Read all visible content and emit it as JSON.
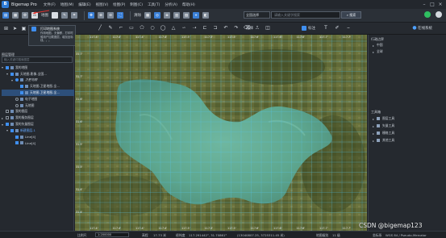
{
  "app": {
    "title": "Bigemap Pro",
    "logo_letter": "B",
    "menus": [
      "文件(F)",
      "地图(M)",
      "编辑(E)",
      "视图(V)",
      "绘图(P)",
      "制图(C)",
      "工具(T)",
      "分析(A)",
      "帮助(H)"
    ]
  },
  "toolbar1": {
    "map_label": "地图",
    "clear_label": "清除",
    "province_select": "全国选择",
    "search_placeholder": "请输入关键字搜索",
    "search_button": "搜索"
  },
  "toolbar2": {
    "select_label": "选择",
    "measure_label": "测量",
    "report_label": "上报",
    "marker_label": "标注",
    "online_label": "在线系统"
  },
  "left_panel": {
    "title": "图层管理",
    "search_placeholder": "输入关键词搜索图层",
    "popup": {
      "title": "打印地图系统",
      "description": "作用地图，无偏移，打印时候用户加载图层，增加坐标线。。。"
    },
    "tree": [
      {
        "label": "我的地图",
        "level": 0,
        "chev": "▾",
        "kind": "cb",
        "on": true
      },
      {
        "label": "天地图-影像-全国...",
        "level": 1,
        "chev": "▾",
        "kind": "cb",
        "on": true
      },
      {
        "label": "卫星地图",
        "level": 2,
        "chev": "▾",
        "kind": "radio",
        "on": true,
        "italic": true
      },
      {
        "label": "天地图-卫星地图-全...",
        "level": 3,
        "chev": "",
        "kind": "cb",
        "on": true
      },
      {
        "label": "天地图-卫星地图-全...",
        "level": 3,
        "chev": "",
        "kind": "cb",
        "on": true,
        "selected": true
      },
      {
        "label": "电子地图",
        "level": 2,
        "chev": "",
        "kind": "radio",
        "on": false
      },
      {
        "label": "无地图",
        "level": 2,
        "chev": "",
        "kind": "radio",
        "on": false
      },
      {
        "label": "我的图层",
        "level": 0,
        "chev": "",
        "kind": "cb",
        "on": false
      },
      {
        "label": "我的服务图层",
        "level": 0,
        "chev": "▸",
        "kind": "cb",
        "on": false
      },
      {
        "label": "我的矢量图层",
        "level": 0,
        "chev": "▾",
        "kind": "cb",
        "on": true
      },
      {
        "label": "新建图层-1",
        "level": 1,
        "chev": "▾",
        "kind": "cb",
        "on": true,
        "blue": true
      },
      {
        "label": "Line[4]",
        "level": 2,
        "chev": "",
        "kind": "cb",
        "on": true
      },
      {
        "label": "Line[4]",
        "level": 2,
        "chev": "",
        "kind": "cb",
        "on": true
      }
    ]
  },
  "map": {
    "top_ticks": [
      "117.4'",
      "117.4'",
      "117.4'",
      "117.4'",
      "117.5'",
      "117.5'",
      "117.5'",
      "117.6'",
      "117.6'",
      "117.6'",
      "117.7'",
      "117.7'"
    ],
    "bottom_ticks": [
      "117.4'",
      "117.4'",
      "117.4'",
      "117.4'",
      "117.5'",
      "117.5'",
      "117.5'",
      "117.6'",
      "117.6'",
      "117.6'",
      "117.7'",
      "117.7'"
    ],
    "left_ticks": [
      "31.7'",
      "31.7'",
      "31.6'",
      "31.6'",
      "31.5'",
      "31.5'",
      "31.4'",
      "31.4'"
    ]
  },
  "right_panel": {
    "section1_title": "行政边界",
    "section1_items": [
      "中国",
      "全球"
    ],
    "section2_title": "工具箱",
    "section2_items": [
      "图层工具",
      "矢量工具",
      "栅格工具",
      "其他工具"
    ]
  },
  "statusbar": {
    "scale_label": "比例尺",
    "scale_value": "1:200000",
    "elev_label": "高程",
    "elev_value": "17.73 米",
    "coords_label": "经纬度",
    "coords_value": "117.291442°, 31.70861°",
    "plane_label": "坐标",
    "plane_value": "(13040807.25, 3725311.45 米)",
    "level_label": "地图级别",
    "level_value": "11 级",
    "crs_label": "坐标系",
    "crs_value": "WGS 84 / Pseudo-Mercator"
  },
  "watermark": "CSDN @bigemap123"
}
